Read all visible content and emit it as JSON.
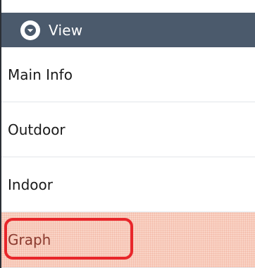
{
  "menu": {
    "header": {
      "title": "View",
      "icon": "chevron-down-circle-icon"
    },
    "items": [
      {
        "label": "Main Info"
      },
      {
        "label": "Outdoor"
      },
      {
        "label": "Indoor"
      },
      {
        "label": "Graph",
        "highlighted": true
      }
    ]
  },
  "colors": {
    "header_bg": "#4b5a6c",
    "highlight_border": "#e8262a",
    "highlight_fill": "#f9d4c6"
  }
}
